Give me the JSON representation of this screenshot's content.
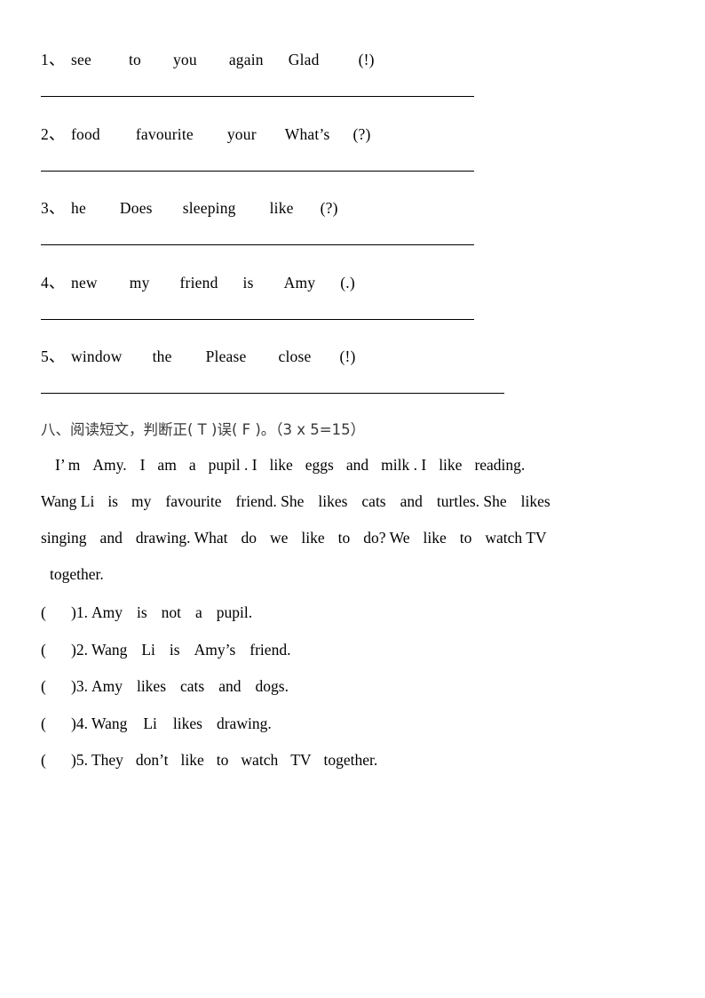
{
  "document": {
    "page_background": "#ffffff",
    "text_color": "#000000"
  },
  "reorder_exercise": {
    "items": [
      {
        "number": "1、",
        "words": [
          "see",
          "to",
          "you",
          "again",
          "Glad",
          "(!)"
        ],
        "gaps": [
          42,
          36,
          36,
          28,
          44
        ],
        "rule_width": 488
      },
      {
        "number": "2、",
        "words": [
          "food",
          "favourite",
          "your",
          "What’s",
          "(?)"
        ],
        "gaps": [
          40,
          38,
          32,
          26
        ],
        "rule_width": 488
      },
      {
        "number": "3、",
        "words": [
          "he",
          "Does",
          "sleeping",
          "like",
          "(?)"
        ],
        "gaps": [
          38,
          34,
          38,
          30
        ],
        "rule_width": 488
      },
      {
        "number": "4、",
        "words": [
          "new",
          "my",
          "friend",
          "is",
          "Amy",
          "(.)"
        ],
        "gaps": [
          36,
          34,
          28,
          34,
          28
        ],
        "rule_width": 488
      },
      {
        "number": "5、",
        "words": [
          "window",
          "the",
          "Please",
          "close",
          "(!)"
        ],
        "gaps": [
          34,
          38,
          36,
          32
        ],
        "rule_width": 522
      }
    ]
  },
  "section_eight": {
    "heading": "八、阅读短文，判断正( T )误( F )。（3 x 5=15）"
  },
  "passage": {
    "lines": [
      {
        "indent": "indent-sm",
        "tokens": [
          "I’ m",
          "Amy.",
          "I",
          "am",
          "a",
          "pupil . I",
          "like",
          "eggs",
          "and",
          "milk . I",
          "like",
          "reading."
        ],
        "gaps": [
          14,
          15,
          14,
          14,
          14,
          14,
          14,
          14,
          14,
          14,
          14
        ]
      },
      {
        "indent": "",
        "tokens": [
          "Wang Li",
          "is",
          "my",
          "favourite",
          "friend. She",
          "likes",
          "cats",
          "and",
          "turtles. She",
          "likes"
        ],
        "gaps": [
          15,
          15,
          16,
          16,
          16,
          16,
          16,
          16,
          16
        ]
      },
      {
        "indent": "",
        "tokens": [
          "singing",
          "and",
          "drawing. What",
          "do",
          "we",
          "like",
          "to",
          "do? We",
          "like",
          "to",
          "watch TV"
        ],
        "gaps": [
          15,
          15,
          15,
          15,
          15,
          15,
          15,
          15,
          15,
          15
        ]
      },
      {
        "indent": "indent-xs",
        "tokens": [
          "together."
        ],
        "gaps": []
      }
    ]
  },
  "true_false_questions": {
    "blank_mark": "(",
    "items": [
      {
        "close_and_number": ")1.",
        "tokens": [
          "Amy",
          "is",
          "not",
          "a",
          "pupil."
        ],
        "gaps": [
          16,
          16,
          16,
          16
        ]
      },
      {
        "close_and_number": ")2.",
        "tokens": [
          "Wang",
          "Li",
          "is",
          "Amy’s",
          "friend."
        ],
        "gaps": [
          16,
          16,
          16,
          16
        ]
      },
      {
        "close_and_number": ")3.",
        "tokens": [
          "Amy",
          "likes",
          "cats",
          "and",
          "dogs."
        ],
        "gaps": [
          16,
          16,
          16,
          16
        ]
      },
      {
        "close_and_number": ")4.",
        "tokens": [
          "Wang",
          "Li",
          "likes",
          "drawing."
        ],
        "gaps": [
          18,
          18,
          16
        ]
      },
      {
        "close_and_number": ")5.",
        "tokens": [
          "They",
          "don’t",
          "like",
          "to",
          "watch",
          "TV",
          "together."
        ],
        "gaps": [
          14,
          14,
          14,
          14,
          14,
          14
        ]
      }
    ]
  }
}
